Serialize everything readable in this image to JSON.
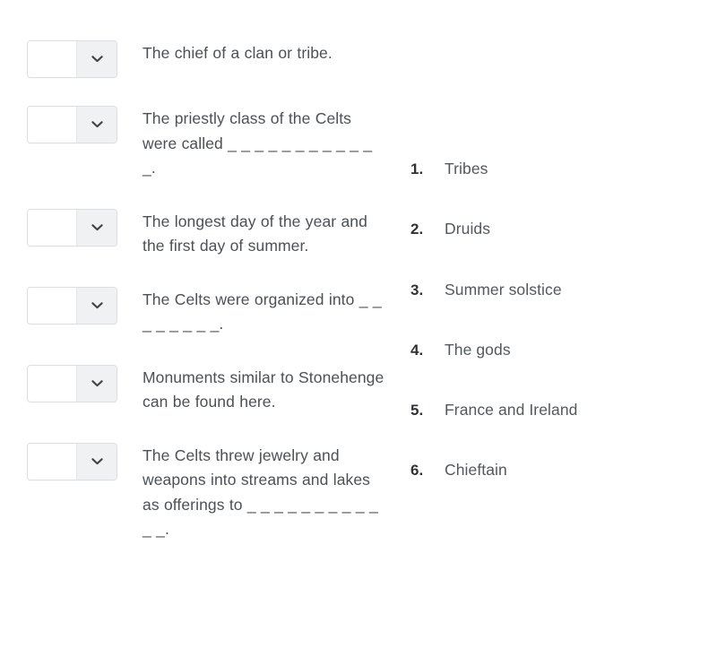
{
  "page": {
    "background_color": "#ffffff",
    "question_text_color": "#4c5155",
    "answer_number_color": "#2f3336",
    "answer_label_color": "#53585c",
    "dropdown_border_color": "#dcdfe2",
    "dropdown_arrow_bg_color": "#f0f1f3",
    "chevron_color": "#3f4448"
  },
  "questions": [
    {
      "dropdown": {
        "value": "",
        "placeholder": "",
        "icon": "chevron-down-icon"
      },
      "prompt": "The chief of a clan or tribe."
    },
    {
      "dropdown": {
        "value": "",
        "placeholder": "",
        "icon": "chevron-down-icon"
      },
      "prompt": "The priestly class of the Celts were called _ _ _ _ _ _ _ _ _ _ _ _."
    },
    {
      "dropdown": {
        "value": "",
        "placeholder": "",
        "icon": "chevron-down-icon"
      },
      "prompt": "The longest day of the year and the first day of summer."
    },
    {
      "dropdown": {
        "value": "",
        "placeholder": "",
        "icon": "chevron-down-icon"
      },
      "prompt": "The Celts were organized into _ _ _ _ _ _ _ _."
    },
    {
      "dropdown": {
        "value": "",
        "placeholder": "",
        "icon": "chevron-down-icon"
      },
      "prompt": "Monuments similar to Stonehenge can be found here."
    },
    {
      "dropdown": {
        "value": "",
        "placeholder": "",
        "icon": "chevron-down-icon"
      },
      "prompt": "The Celts threw jewelry and weapons into streams and lakes as offerings to _ _ _ _ _ _ _ _ _ _ _ _."
    }
  ],
  "answers": [
    {
      "number": "1.",
      "label": "Tribes"
    },
    {
      "number": "2.",
      "label": "Druids"
    },
    {
      "number": "3.",
      "label": "Summer solstice"
    },
    {
      "number": "4.",
      "label": "The gods"
    },
    {
      "number": "5.",
      "label": "France and Ireland"
    },
    {
      "number": "6.",
      "label": "Chieftain"
    }
  ]
}
